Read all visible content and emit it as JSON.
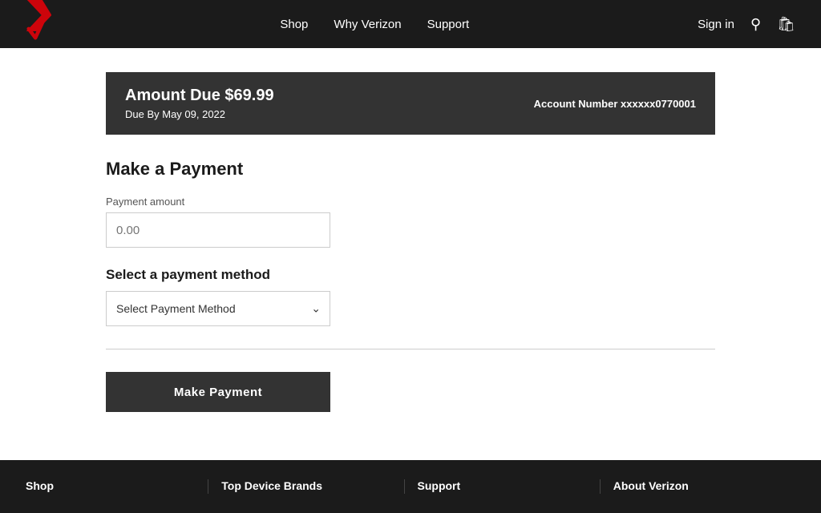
{
  "nav": {
    "links": [
      {
        "label": "Shop",
        "id": "shop"
      },
      {
        "label": "Why Verizon",
        "id": "why-verizon"
      },
      {
        "label": "Support",
        "id": "support"
      }
    ],
    "sign_in": "Sign in"
  },
  "banner": {
    "amount_label": "Amount Due $69.99",
    "due_date": "Due By May 09, 2022",
    "account_prefix": "Account Number ",
    "account_number": "xxxxxx0770001"
  },
  "form": {
    "page_title": "Make a Payment",
    "payment_amount_label": "Payment amount",
    "payment_amount_placeholder": "0.00",
    "select_method_label": "Select a payment method",
    "select_placeholder": "Select Payment Method",
    "submit_button": "Make Payment"
  },
  "footer": {
    "columns": [
      {
        "title": "Shop"
      },
      {
        "title": "Top Device Brands"
      },
      {
        "title": "Support"
      },
      {
        "title": "About Verizon"
      }
    ]
  }
}
